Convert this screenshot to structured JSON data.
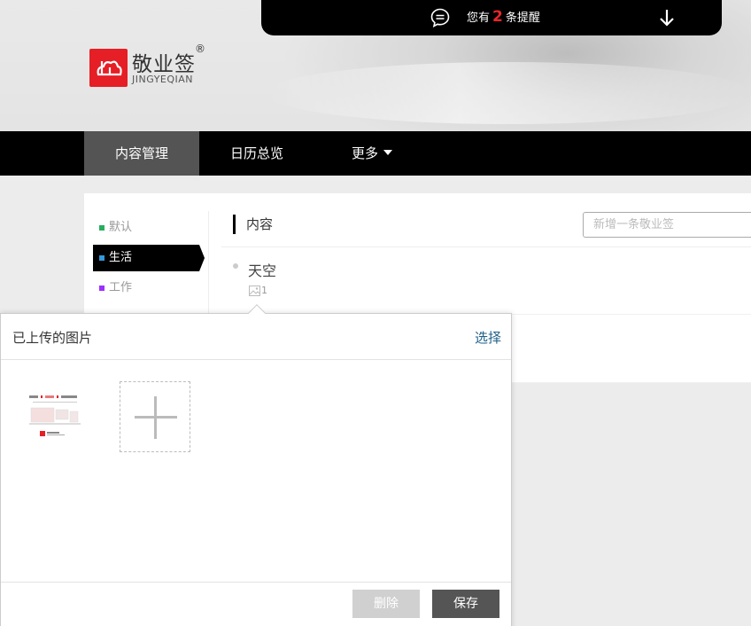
{
  "notification": {
    "prefix": "您有",
    "count": "2",
    "suffix": "条提醒",
    "icon": "chat-bubble-icon",
    "expand_icon": "arrow-down-icon"
  },
  "brand": {
    "name": "敬业签",
    "registered": "®",
    "pinyin": "JINGYEQIAN",
    "color": "#e61e25"
  },
  "nav": {
    "items": [
      {
        "label": "内容管理"
      },
      {
        "label": "日历总览"
      },
      {
        "label": "更多"
      }
    ]
  },
  "categories": [
    {
      "label": "默认",
      "color": "#27ae60"
    },
    {
      "label": "生活",
      "color": "#3498db"
    },
    {
      "label": "工作",
      "color": "#9b30ff"
    }
  ],
  "content": {
    "title": "内容",
    "new_placeholder": "新增一条敬业签",
    "entries": [
      {
        "title": "天空",
        "image_count": "1"
      }
    ]
  },
  "upload_popup": {
    "title": "已上传的图片",
    "select_label": "选择",
    "delete_label": "删除",
    "save_label": "保存"
  }
}
